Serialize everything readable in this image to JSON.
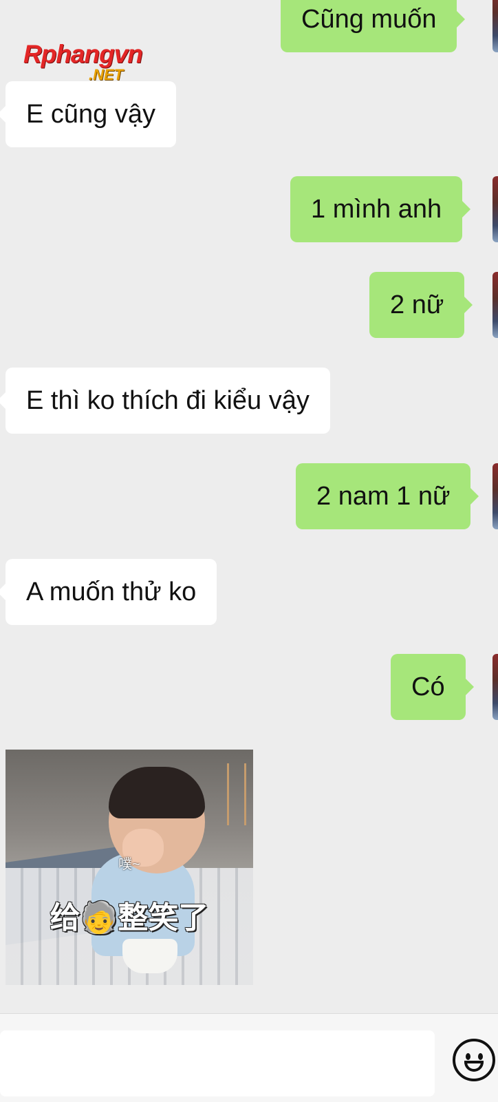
{
  "watermark": {
    "main": "Rphangvn",
    "sub": ".NET"
  },
  "messages": [
    {
      "side": "right",
      "text": "Cũng muốn"
    },
    {
      "side": "left",
      "text": "E cũng vậy"
    },
    {
      "side": "right",
      "text": "1 mình anh"
    },
    {
      "side": "right",
      "text": "2 nữ"
    },
    {
      "side": "left",
      "text": "E thì ko thích đi kiểu vậy"
    },
    {
      "side": "right",
      "text": "2 nam 1 nữ"
    },
    {
      "side": "left",
      "text": "A muốn thử ko"
    },
    {
      "side": "right",
      "text": "Có"
    }
  ],
  "sticker": {
    "caption_small": "噗~",
    "caption_large": "给🧓整笑了"
  },
  "input": {
    "placeholder": ""
  },
  "icons": {
    "emoji_button": "smiley-face-icon",
    "avatar": "user-avatar"
  },
  "colors": {
    "background": "#ededed",
    "outgoing_bubble": "#a6e67a",
    "incoming_bubble": "#ffffff"
  }
}
